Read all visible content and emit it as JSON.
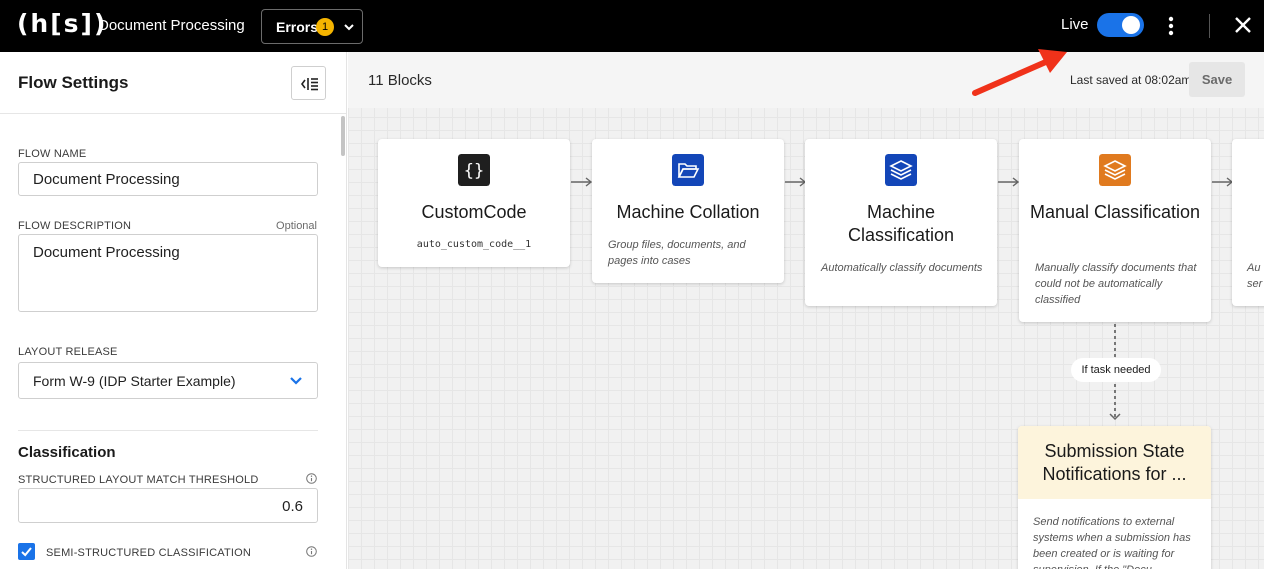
{
  "topbar": {
    "logo": "(h[s])",
    "app_title": "Document Processing",
    "errors_label": "Errors",
    "errors_count": "1",
    "live_label": "Live",
    "live_enabled": true
  },
  "sidebar": {
    "title": "Flow Settings",
    "flow_name_label": "FLOW NAME",
    "flow_name_value": "Document Processing",
    "flow_description_label": "FLOW DESCRIPTION",
    "flow_description_optional": "Optional",
    "flow_description_value": "Document Processing",
    "layout_release_label": "LAYOUT RELEASE",
    "layout_release_value": "Form W-9 (IDP Starter Example)",
    "classification_title": "Classification",
    "threshold_label": "STRUCTURED LAYOUT MATCH THRESHOLD",
    "threshold_value": "0.6",
    "semi_structured_label": "SEMI-STRUCTURED CLASSIFICATION",
    "semi_structured_checked": true
  },
  "canvas": {
    "blocks_count": "11 Blocks",
    "last_saved": "Last saved at 08:02am",
    "save_label": "Save",
    "blocks": [
      {
        "title": "CustomCode",
        "subtitle": "auto_custom_code__1",
        "icon": "braces-icon",
        "color": "#1f1f1f"
      },
      {
        "title": "Machine Collation",
        "description": "Group files, documents, and pages into cases",
        "icon": "folder-open-icon",
        "color": "#1346b8"
      },
      {
        "title": "Machine Classification",
        "description": "Automatically classify documents",
        "icon": "layers-icon",
        "color": "#1346b8"
      },
      {
        "title": "Manual Classification",
        "description": "Manually classify documents that could not be automatically classified",
        "icon": "layers-icon",
        "color": "#e07a1f"
      },
      {
        "description_partial_1": "Au",
        "description_partial_2": "ser"
      }
    ],
    "condition_label": "If task needed",
    "notification_block": {
      "title": "Submission State Notifications for ...",
      "description": "Send notifications to external systems when a submission has been created or is waiting for supervision. If the \"Docu"
    }
  }
}
